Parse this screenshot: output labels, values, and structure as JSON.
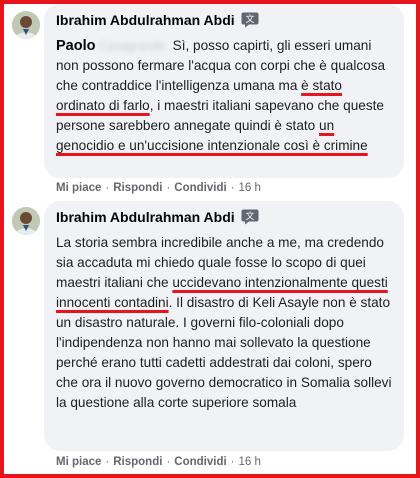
{
  "comments": [
    {
      "author": "Ibrahim Abdulrahman Abdi",
      "mention": "Paolo",
      "mention_blurred": "Casagrande",
      "segments": [
        {
          "text": " Sì, posso capirti, gli esseri umani non possono fermare l'acqua con corpi che è qualcosa che contraddice l'intelligenza umana ma ",
          "u": false
        },
        {
          "text": "è stato ordinato di farlo",
          "u": true
        },
        {
          "text": ", i maestri italiani sapevano che queste persone sarebbero annegate quindi è stato ",
          "u": false
        },
        {
          "text": "un genocidio e un'uccisione intenzionale così è crimine",
          "u": true
        }
      ],
      "actions": {
        "like": "Mi piace",
        "reply": "Rispondi",
        "share": "Condividi",
        "time": "16 h"
      }
    },
    {
      "author": "Ibrahim Abdulrahman Abdi",
      "segments": [
        {
          "text": "La storia sembra incredibile anche a me, ma credendo sia accaduta mi chiedo quale fosse lo scopo di quei maestri italiani che ",
          "u": false
        },
        {
          "text": "uccidevano intenzionalmente questi innocenti contadini",
          "u": true
        },
        {
          "text": ". Il disastro di Keli Asayle non è stato un disastro naturale. I governi filo-coloniali dopo l'indipendenza non hanno mai sollevato la questione perché erano tutti cadetti addestrati dai coloni, spero che ora il nuovo governo democratico in Somalia sollevi la questione alla corte superiore somala",
          "u": false
        }
      ],
      "actions": {
        "like": "Mi piace",
        "reply": "Rispondi",
        "share": "Condividi",
        "time": "16 h"
      }
    }
  ],
  "colors": {
    "highlight": "#e8141c",
    "bubble": "#f0f2f5",
    "meta": "#65676b"
  },
  "icons": [
    "avatar",
    "translate-icon"
  ]
}
